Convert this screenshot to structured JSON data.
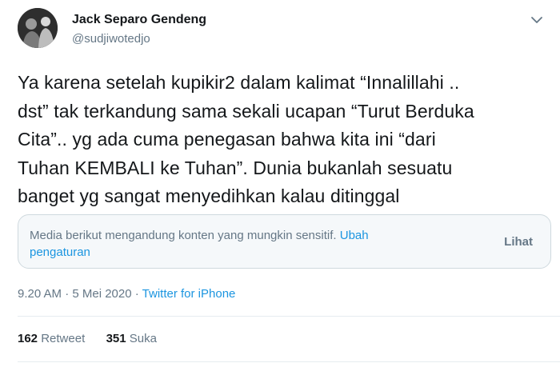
{
  "author": {
    "display_name": "Jack Separo Gendeng",
    "handle": "@sudjiwotedjo"
  },
  "tweet": {
    "lines": [
      "Ya karena setelah kupikir2 dalam kalimat “Innalillahi ..",
      "dst” tak terkandung sama sekali ucapan “Turut Berduka",
      "Cita”.. yg ada cuma penegasan bahwa kita ini “dari",
      "Tuhan KEMBALI ke Tuhan”. Dunia bukanlah sesuatu",
      "banget yg sangat menyedihkan kalau ditinggal"
    ]
  },
  "media_warning": {
    "message": "Media berikut mengandung konten yang mungkin sensitif.",
    "settings_link": "Ubah pengaturan",
    "view_label": "Lihat"
  },
  "meta": {
    "timestamp": "9.20 AM · 5 Mei 2020 ·",
    "source": "Twitter for iPhone"
  },
  "stats": {
    "retweets_count": "162",
    "retweets_label": "Retweet",
    "likes_count": "351",
    "likes_label": "Suka"
  },
  "icons": {
    "caret": "chevron-down-icon"
  }
}
